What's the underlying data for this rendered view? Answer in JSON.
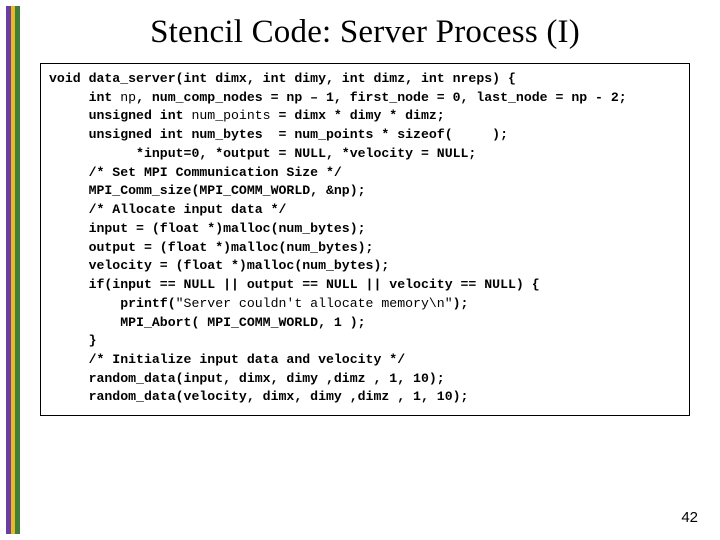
{
  "accent": {
    "colors": [
      "#6a3fa0",
      "#e8b923",
      "#3f7f3a"
    ]
  },
  "title": "Stencil Code: Server Process (I)",
  "page_number": "42",
  "code": {
    "l01a": "void data_server(int dimx, int dimy, int dimz, int nreps) {",
    "l02a": "     int ",
    "l02b": "np",
    "l02c": ", num_comp_nodes = np – 1, first_node = 0, last_node = np - 2;",
    "l03a": "     unsigned int ",
    "l03b": "num_points",
    "l03c": " = dimx * dimy * dimz;",
    "l04a": "     unsigned int num_bytes  = num_points * sizeof(     );",
    "l05a": "           *input=0, *output = NULL, *velocity = NULL;",
    "l06a": "     /* Set MPI Communication Size */",
    "l07a": "     MPI_Comm_size(MPI_COMM_WORLD, &np);",
    "l08a": "     /* Allocate input data */",
    "l09a": "     input = (float *)malloc(num_bytes);",
    "l10a": "     output = (float *)malloc(num_bytes);",
    "l11a": "     velocity = (float *)malloc(num_bytes);",
    "l12a": "     if(input == NULL || output == NULL || velocity == NULL) {",
    "l13a": "         printf(",
    "l13b": "\"Server couldn't allocate memory\\n\"",
    "l13c": ");",
    "l14a": "         MPI_Abort( MPI_COMM_WORLD, 1 );",
    "l15a": "     }",
    "l16a": "     /* Initialize input data and velocity */",
    "l17a": "     random_data(input, dimx, dimy ,dimz , 1, 10);",
    "l18a": "     random_data(velocity, dimx, dimy ,dimz , 1, 10);"
  }
}
